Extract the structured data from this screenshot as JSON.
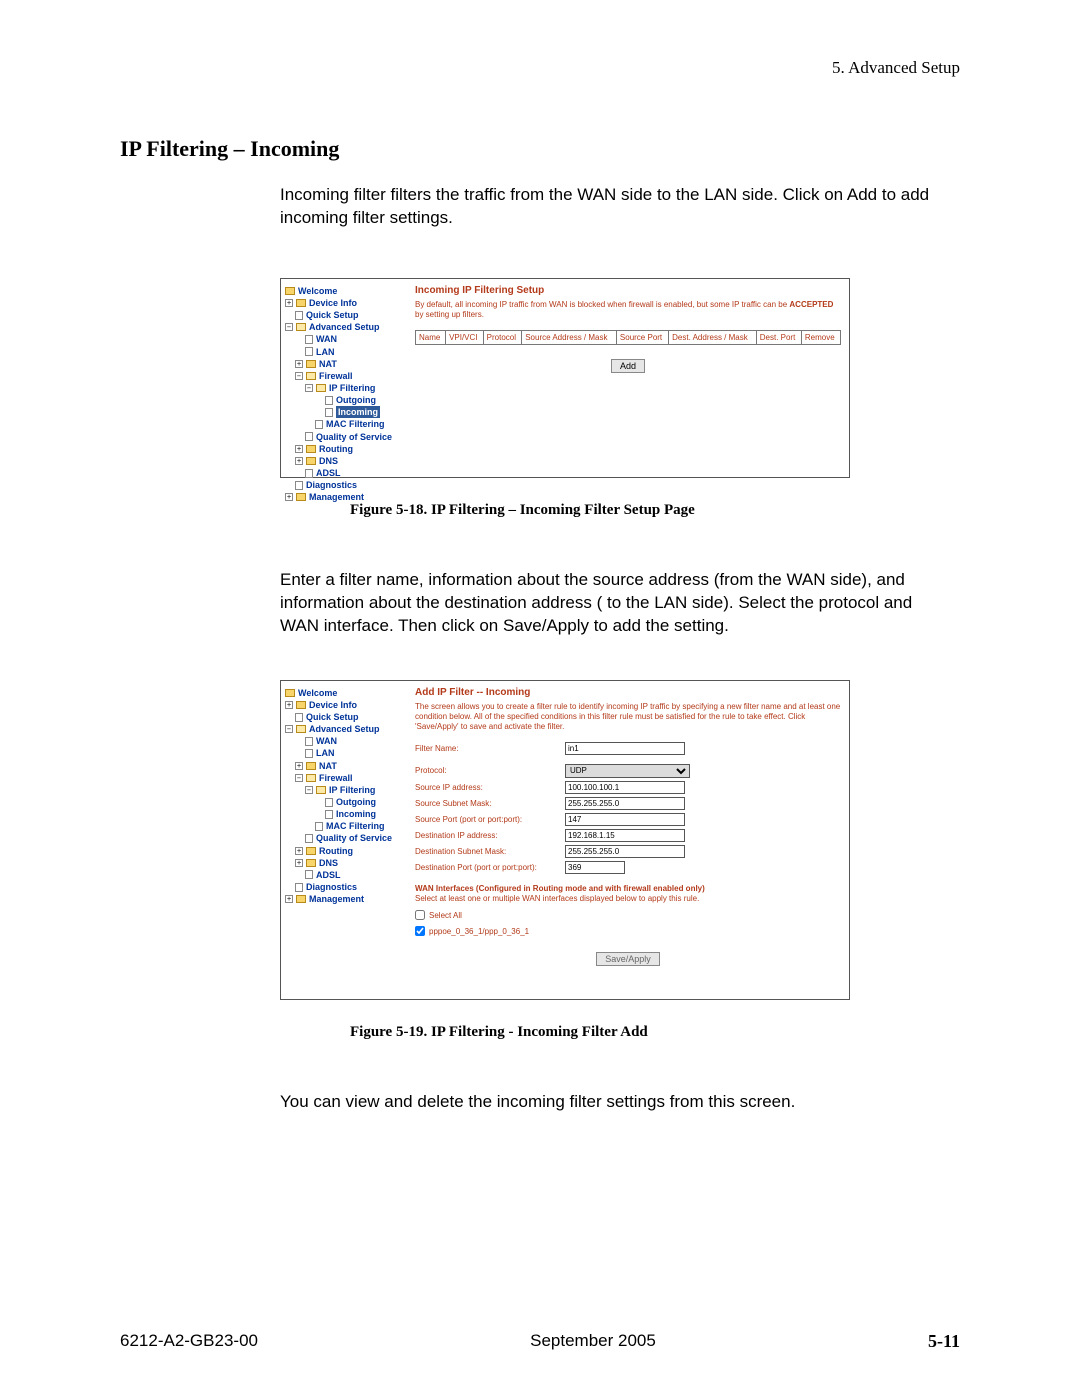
{
  "header": {
    "chapter": "5. Advanced Setup"
  },
  "section_title": "IP Filtering – Incoming",
  "para1": "Incoming filter filters the traffic from the WAN side to the LAN side. Click on Add to add incoming filter settings.",
  "para2": "Enter a filter name, information about the source address (from the WAN side), and information about the destination address ( to the LAN side). Select the protocol and WAN interface. Then click on Save/Apply to add the setting.",
  "para3": "You can view and delete the incoming filter settings from this screen.",
  "nav": {
    "welcome": "Welcome",
    "device_info": "Device Info",
    "quick_setup": "Quick Setup",
    "advanced_setup": "Advanced Setup",
    "wan": "WAN",
    "lan": "LAN",
    "nat": "NAT",
    "firewall": "Firewall",
    "ip_filtering": "IP Filtering",
    "outgoing": "Outgoing",
    "incoming": "Incoming",
    "mac_filtering": "MAC Filtering",
    "qos": "Quality of Service",
    "routing": "Routing",
    "dns": "DNS",
    "adsl": "ADSL",
    "diagnostics": "Diagnostics",
    "management": "Management"
  },
  "fig1": {
    "title": "Incoming IP Filtering Setup",
    "desc_a": "By default, all incoming IP traffic from WAN is blocked when firewall is enabled, but some IP traffic can be ",
    "accepted": "ACCEPTED",
    "desc_b": " by setting up filters.",
    "cols": {
      "name": "Name",
      "vpivci": "VPI/VCI",
      "protocol": "Protocol",
      "src_addr": "Source Address / Mask",
      "src_port": "Source Port",
      "dst_addr": "Dest. Address / Mask",
      "dst_port": "Dest. Port",
      "remove": "Remove"
    },
    "add_btn": "Add",
    "caption": "Figure 5-18.   IP Filtering – Incoming Filter Setup Page"
  },
  "fig2": {
    "title": "Add IP Filter -- Incoming",
    "desc": "The screen allows you to create a filter rule to identify incoming IP traffic by specifying a new filter name and at least one condition below. All of the specified conditions in this filter rule must be satisfied for the rule to take effect. Click 'Save/Apply' to save and activate the filter.",
    "labels": {
      "filter_name": "Filter Name:",
      "protocol": "Protocol:",
      "src_ip": "Source IP address:",
      "src_mask": "Source Subnet Mask:",
      "src_port": "Source Port (port or port:port):",
      "dst_ip": "Destination IP address:",
      "dst_mask": "Destination Subnet Mask:",
      "dst_port": "Destination Port (port or port:port):"
    },
    "values": {
      "filter_name": "in1",
      "protocol": "UDP",
      "src_ip": "100.100.100.1",
      "src_mask": "255.255.255.0",
      "src_port": "147",
      "dst_ip": "192.168.1.15",
      "dst_mask": "255.255.255.0",
      "dst_port": "369"
    },
    "wan_title": "WAN Interfaces (Configured in Routing mode and with firewall enabled only)",
    "wan_instr": "Select at least one or multiple WAN interfaces displayed below to apply this rule.",
    "select_all": "Select All",
    "iface": "pppoe_0_36_1/ppp_0_36_1",
    "save_btn": "Save/Apply",
    "caption": "Figure 5-19.   IP Filtering - Incoming Filter Add"
  },
  "footer": {
    "left": "6212-A2-GB23-00",
    "center": "September 2005",
    "right": "5-11"
  }
}
